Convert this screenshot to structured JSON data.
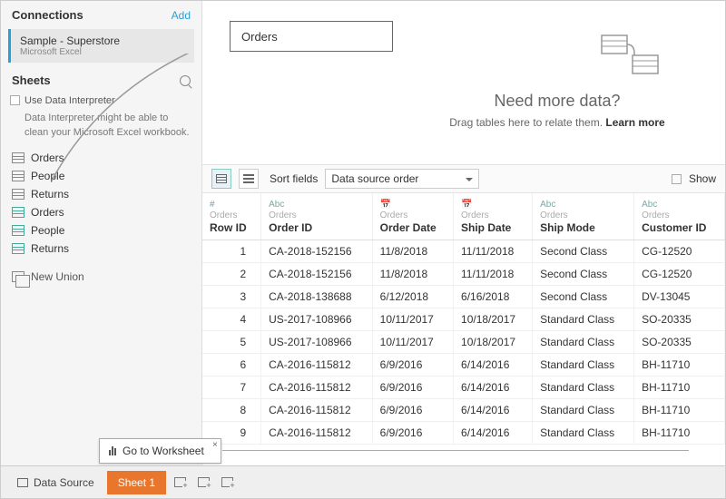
{
  "sidebar": {
    "connections_title": "Connections",
    "add_label": "Add",
    "connection": {
      "name": "Sample - Superstore",
      "type": "Microsoft Excel"
    },
    "sheets_title": "Sheets",
    "interpreter_label": "Use Data Interpreter",
    "interpreter_help": "Data Interpreter might be able to clean your Microsoft Excel workbook.",
    "sheets": [
      {
        "label": "Orders",
        "kind": "plain"
      },
      {
        "label": "People",
        "kind": "plain"
      },
      {
        "label": "Returns",
        "kind": "plain"
      },
      {
        "label": "Orders",
        "kind": "named"
      },
      {
        "label": "People",
        "kind": "named"
      },
      {
        "label": "Returns",
        "kind": "named"
      }
    ],
    "new_union_label": "New Union"
  },
  "canvas": {
    "table_pill": "Orders",
    "need_title": "Need more data?",
    "need_sub_pre": "Drag tables here to relate them. ",
    "need_sub_link": "Learn more"
  },
  "toolbar": {
    "sort_label": "Sort fields",
    "sort_value": "Data source order",
    "show_label": "Show"
  },
  "grid": {
    "columns": [
      {
        "type": "#",
        "type_class": "num",
        "src": "Orders",
        "name": "Row ID"
      },
      {
        "type": "Abc",
        "type_class": "",
        "src": "Orders",
        "name": "Order ID"
      },
      {
        "type": "📅",
        "type_class": "date",
        "src": "Orders",
        "name": "Order Date"
      },
      {
        "type": "📅",
        "type_class": "date",
        "src": "Orders",
        "name": "Ship Date"
      },
      {
        "type": "Abc",
        "type_class": "",
        "src": "Orders",
        "name": "Ship Mode"
      },
      {
        "type": "Abc",
        "type_class": "",
        "src": "Orders",
        "name": "Customer ID"
      }
    ],
    "rows": [
      {
        "row_id": "1",
        "order_id": "CA-2018-152156",
        "order_date": "11/8/2018",
        "ship_date": "11/11/2018",
        "ship_mode": "Second Class",
        "cust": "CG-12520"
      },
      {
        "row_id": "2",
        "order_id": "CA-2018-152156",
        "order_date": "11/8/2018",
        "ship_date": "11/11/2018",
        "ship_mode": "Second Class",
        "cust": "CG-12520"
      },
      {
        "row_id": "3",
        "order_id": "CA-2018-138688",
        "order_date": "6/12/2018",
        "ship_date": "6/16/2018",
        "ship_mode": "Second Class",
        "cust": "DV-13045"
      },
      {
        "row_id": "4",
        "order_id": "US-2017-108966",
        "order_date": "10/11/2017",
        "ship_date": "10/18/2017",
        "ship_mode": "Standard Class",
        "cust": "SO-20335"
      },
      {
        "row_id": "5",
        "order_id": "US-2017-108966",
        "order_date": "10/11/2017",
        "ship_date": "10/18/2017",
        "ship_mode": "Standard Class",
        "cust": "SO-20335"
      },
      {
        "row_id": "6",
        "order_id": "CA-2016-115812",
        "order_date": "6/9/2016",
        "ship_date": "6/14/2016",
        "ship_mode": "Standard Class",
        "cust": "BH-11710"
      },
      {
        "row_id": "7",
        "order_id": "CA-2016-115812",
        "order_date": "6/9/2016",
        "ship_date": "6/14/2016",
        "ship_mode": "Standard Class",
        "cust": "BH-11710"
      },
      {
        "row_id": "8",
        "order_id": "CA-2016-115812",
        "order_date": "6/9/2016",
        "ship_date": "6/14/2016",
        "ship_mode": "Standard Class",
        "cust": "BH-11710"
      },
      {
        "row_id": "9",
        "order_id": "CA-2016-115812",
        "order_date": "6/9/2016",
        "ship_date": "6/14/2016",
        "ship_mode": "Standard Class",
        "cust": "BH-11710"
      }
    ]
  },
  "bottom": {
    "data_source_label": "Data Source",
    "sheet_tab": "Sheet 1",
    "tooltip": "Go to Worksheet"
  }
}
